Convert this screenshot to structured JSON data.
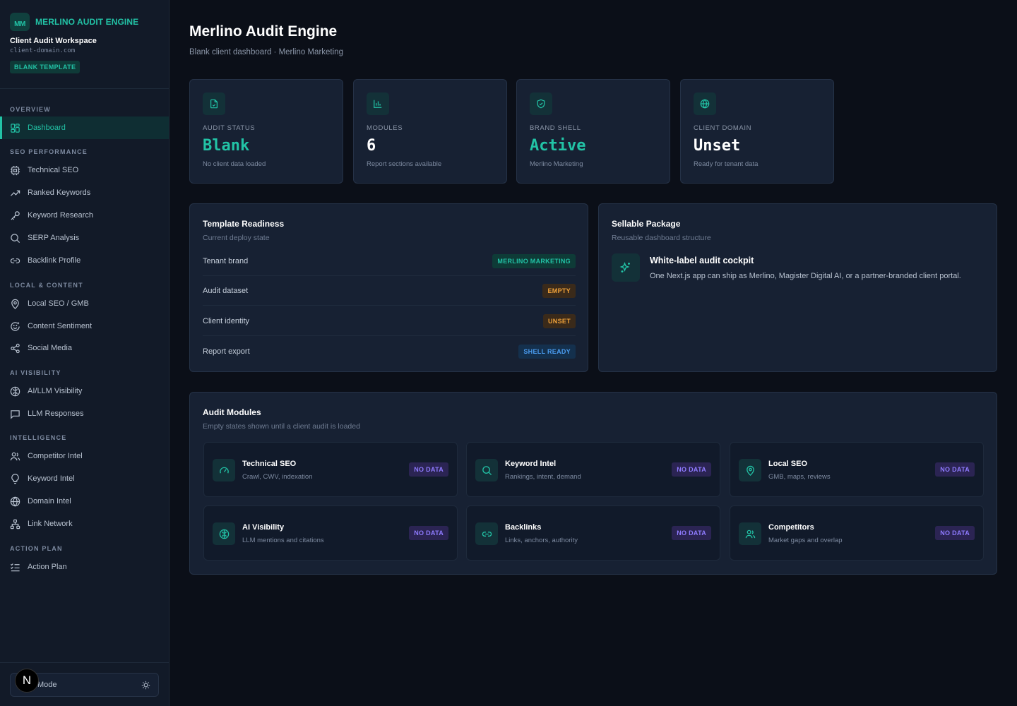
{
  "brand": {
    "mark": "MM",
    "name": "MERLINO AUDIT ENGINE",
    "workspace": "Client Audit Workspace",
    "domain": "client-domain.com",
    "template_badge": "BLANK TEMPLATE"
  },
  "nav": {
    "sections": {
      "overview": "OVERVIEW",
      "seo": "SEO PERFORMANCE",
      "local": "LOCAL & CONTENT",
      "ai": "AI VISIBILITY",
      "intel": "INTELLIGENCE",
      "action": "ACTION PLAN"
    },
    "items": {
      "dashboard": "Dashboard",
      "technical_seo": "Technical SEO",
      "ranked_keywords": "Ranked Keywords",
      "keyword_research": "Keyword Research",
      "serp_analysis": "SERP Analysis",
      "backlink_profile": "Backlink Profile",
      "local_seo": "Local SEO / GMB",
      "content_sentiment": "Content Sentiment",
      "social_media": "Social Media",
      "ai_llm_visibility": "AI/LLM Visibility",
      "llm_responses": "LLM Responses",
      "competitor_intel": "Competitor Intel",
      "keyword_intel": "Keyword Intel",
      "domain_intel": "Domain Intel",
      "link_network": "Link Network",
      "action_plan": "Action Plan"
    }
  },
  "footer": {
    "mode_label": "Mode",
    "n_badge": "N"
  },
  "header": {
    "title": "Merlino Audit Engine",
    "subtitle": "Blank client dashboard · Merlino Marketing"
  },
  "stats": [
    {
      "label": "AUDIT STATUS",
      "value": "Blank",
      "desc": "No client data loaded"
    },
    {
      "label": "MODULES",
      "value": "6",
      "desc": "Report sections available"
    },
    {
      "label": "BRAND SHELL",
      "value": "Active",
      "desc": "Merlino Marketing"
    },
    {
      "label": "CLIENT DOMAIN",
      "value": "Unset",
      "desc": "Ready for tenant data"
    }
  ],
  "readiness": {
    "title": "Template Readiness",
    "subtitle": "Current deploy state",
    "rows": [
      {
        "label": "Tenant brand",
        "status": "MERLINO MARKETING"
      },
      {
        "label": "Audit dataset",
        "status": "EMPTY"
      },
      {
        "label": "Client identity",
        "status": "UNSET"
      },
      {
        "label": "Report export",
        "status": "SHELL READY"
      }
    ]
  },
  "package": {
    "title": "Sellable Package",
    "subtitle": "Reusable dashboard structure",
    "feature_title": "White-label audit cockpit",
    "feature_desc": "One Next.js app can ship as Merlino, Magister Digital AI, or a partner-branded client portal."
  },
  "modules": {
    "title": "Audit Modules",
    "subtitle": "Empty states shown until a client audit is loaded",
    "items": [
      {
        "title": "Technical SEO",
        "desc": "Crawl, CWV, indexation",
        "status": "NO DATA"
      },
      {
        "title": "Keyword Intel",
        "desc": "Rankings, intent, demand",
        "status": "NO DATA"
      },
      {
        "title": "Local SEO",
        "desc": "GMB, maps, reviews",
        "status": "NO DATA"
      },
      {
        "title": "AI Visibility",
        "desc": "LLM mentions and citations",
        "status": "NO DATA"
      },
      {
        "title": "Backlinks",
        "desc": "Links, anchors, authority",
        "status": "NO DATA"
      },
      {
        "title": "Competitors",
        "desc": "Market gaps and overlap",
        "status": "NO DATA"
      }
    ]
  },
  "colors": {
    "accent": "#22c3a6",
    "background": "#0b0f18",
    "sidebar": "#121a28",
    "card": "#172133",
    "warning": "#f0a23a",
    "info": "#4a9cf0",
    "nodata": "#8f7bff"
  }
}
